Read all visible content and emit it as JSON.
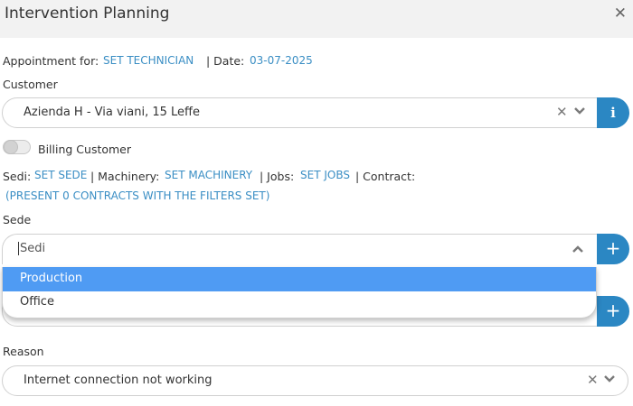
{
  "header": {
    "title": "Intervention Planning",
    "close_icon": "close-icon"
  },
  "appointment": {
    "label": "Appointment for:",
    "technician_link": "SET TECHNICIAN",
    "date_label": "| Date:",
    "date_value": "03-07-2025"
  },
  "customer": {
    "label": "Customer",
    "value": "Azienda H - Via viani, 15 Leffe",
    "info_icon": "info-icon"
  },
  "billing": {
    "label": "Billing Customer",
    "enabled": false
  },
  "links": {
    "sedi_label": "Sedi:",
    "sedi_link": "SET SEDE",
    "machinery_label": "| Machinery:",
    "machinery_link": "SET MACHINERY",
    "jobs_label": "| Jobs:",
    "jobs_link": "SET JOBS",
    "contract_label": "| Contract:",
    "contracts_link": "(PRESENT 0 CONTRACTS WITH THE FILTERS SET)"
  },
  "sede": {
    "label": "Sede",
    "placeholder": "Sedi",
    "options": [
      "Production",
      "Office"
    ],
    "highlighted": "Production"
  },
  "reason": {
    "label": "Reason",
    "value": "Internet connection not working"
  },
  "colors": {
    "accent": "#2b87c3",
    "link": "#3a8ec4",
    "highlight": "#4f9bf3",
    "header_bg": "#f2f2f2"
  }
}
